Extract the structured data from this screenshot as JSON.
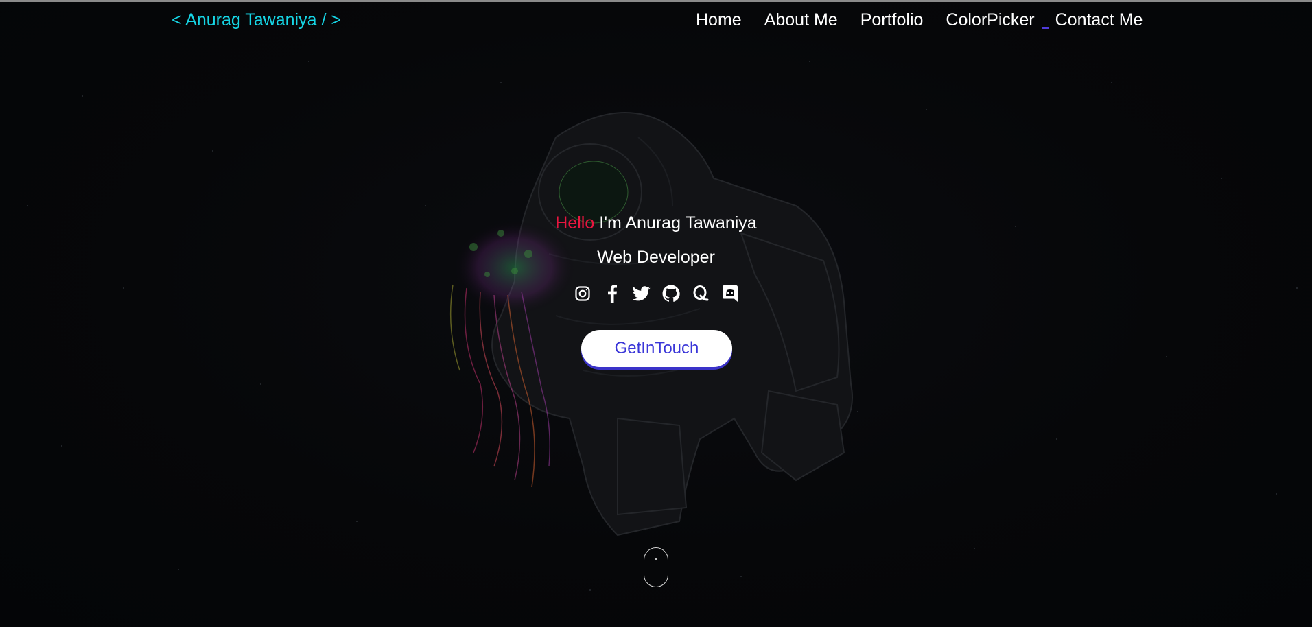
{
  "navbar": {
    "brand": "< Anurag Tawaniya / >",
    "links": [
      "Home",
      "About Me",
      "Portfolio",
      "ColorPicker",
      "Contact Me"
    ]
  },
  "hero": {
    "hello": "Hello",
    "intro": "I'm Anurag Tawaniya",
    "role": "Web Developer",
    "cta_label": "GetInTouch"
  },
  "socials": [
    "instagram-icon",
    "facebook-icon",
    "twitter-icon",
    "github-icon",
    "quora-icon",
    "discord-icon"
  ],
  "colors": {
    "brand": "#16d6e6",
    "hello": "#e8163f",
    "cta_text": "#3a36d8",
    "cta_shadow": "#3b33c9",
    "background": "#050609"
  }
}
